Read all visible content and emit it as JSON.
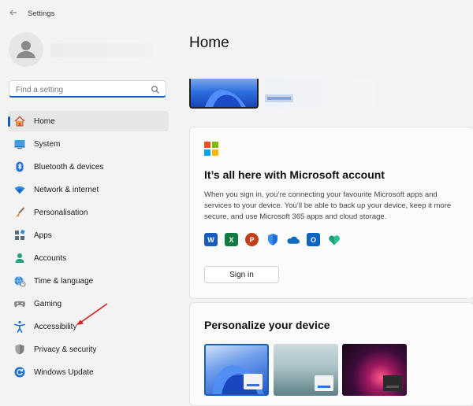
{
  "window": {
    "title": "Settings"
  },
  "search": {
    "placeholder": "Find a setting"
  },
  "sidebar": {
    "items": [
      {
        "label": "Home",
        "icon": "home-icon",
        "active": true
      },
      {
        "label": "System",
        "icon": "system-icon"
      },
      {
        "label": "Bluetooth & devices",
        "icon": "bluetooth-icon"
      },
      {
        "label": "Network & internet",
        "icon": "wifi-icon"
      },
      {
        "label": "Personalisation",
        "icon": "brush-icon"
      },
      {
        "label": "Apps",
        "icon": "apps-icon"
      },
      {
        "label": "Accounts",
        "icon": "person-icon"
      },
      {
        "label": "Time & language",
        "icon": "globe-clock-icon"
      },
      {
        "label": "Gaming",
        "icon": "gamepad-icon"
      },
      {
        "label": "Accessibility",
        "icon": "accessibility-icon"
      },
      {
        "label": "Privacy & security",
        "icon": "shield-icon"
      },
      {
        "label": "Windows Update",
        "icon": "update-icon"
      }
    ]
  },
  "main": {
    "title": "Home",
    "ms_card": {
      "title": "It’s all here with Microsoft account",
      "description": "When you sign in, you’re connecting your favourite Microsoft apps and services to your device. You’ll be able to back up your device, keep it more secure, and use Microsoft 365 apps and cloud storage.",
      "apps": [
        {
          "icon": "word-icon",
          "glyph": "W",
          "color": "#185abd"
        },
        {
          "icon": "excel-icon",
          "glyph": "X",
          "color": "#107c41"
        },
        {
          "icon": "powerpoint-icon",
          "glyph": "P",
          "color": "#c43e1c"
        },
        {
          "icon": "defender-icon",
          "glyph": "",
          "color": "#1b6fd6"
        },
        {
          "icon": "onedrive-icon",
          "glyph": "",
          "color": "#0f6cbd"
        },
        {
          "icon": "outlook-icon",
          "glyph": "O",
          "color": "#0a64c4"
        },
        {
          "icon": "family-icon",
          "glyph": "",
          "color": "#1f9e7a"
        }
      ],
      "signin_label": "Sign in"
    },
    "personalize": {
      "title": "Personalize your device"
    }
  },
  "colors": {
    "accent": "#1a5fb4",
    "annotation_arrow": "#d41f1f"
  }
}
